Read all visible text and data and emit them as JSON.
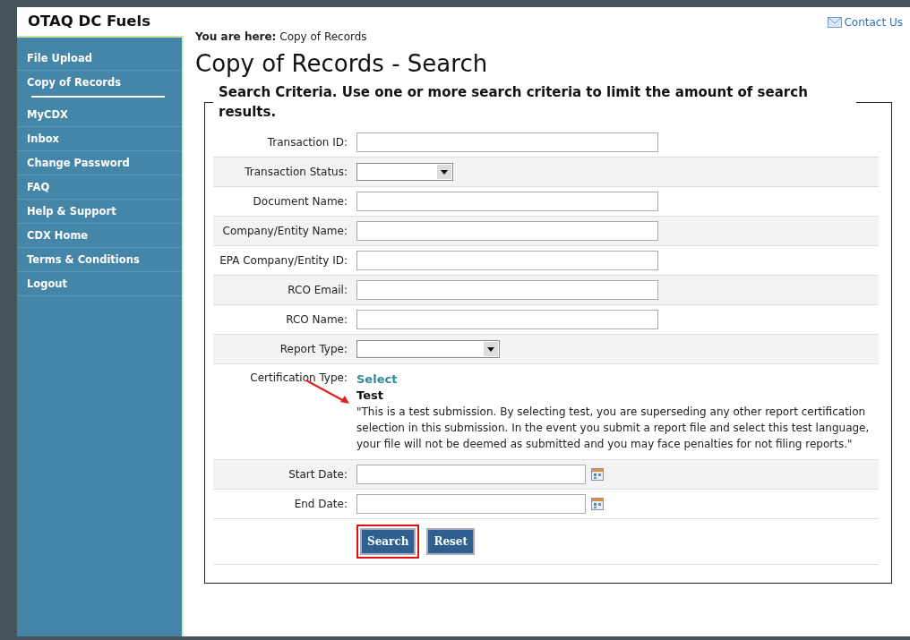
{
  "site_title": "OTAQ DC Fuels",
  "contact_link": "Contact Us",
  "sidebar": {
    "items": [
      {
        "label": "File Upload",
        "selected": false
      },
      {
        "label": "Copy of Records",
        "selected": true
      },
      {
        "label": "MyCDX",
        "selected": false
      },
      {
        "label": "Inbox",
        "selected": false
      },
      {
        "label": "Change Password",
        "selected": false
      },
      {
        "label": "FAQ",
        "selected": false
      },
      {
        "label": "Help & Support",
        "selected": false
      },
      {
        "label": "CDX Home",
        "selected": false
      },
      {
        "label": "Terms & Conditions",
        "selected": false
      },
      {
        "label": "Logout",
        "selected": false
      }
    ]
  },
  "breadcrumb": {
    "prefix": "You are here:",
    "current": "Copy of Records"
  },
  "page_title": "Copy of Records - Search",
  "search_form": {
    "legend": "Search Criteria. Use one or more search criteria to limit the amount of search results.",
    "rows": [
      {
        "kind": "text",
        "label": "Transaction ID:"
      },
      {
        "kind": "select",
        "label": "Transaction Status:"
      },
      {
        "kind": "text",
        "label": "Document Name:"
      },
      {
        "kind": "text",
        "label": "Company/Entity Name:"
      },
      {
        "kind": "text",
        "label": "EPA Company/Entity ID:"
      },
      {
        "kind": "text",
        "label": "RCO Email:"
      },
      {
        "kind": "text",
        "label": "RCO Name:"
      },
      {
        "kind": "wide-select",
        "label": "Report Type:"
      },
      {
        "kind": "certification",
        "label": "Certification Type:",
        "link": "Select",
        "option": "Test",
        "statement": "\"This is a test submission. By selecting test, you are superseding any other report certification selection in this submission. In the event you submit a report file and select this test language, your file will not be deemed as submitted and you may face penalties for not filing reports.\"",
        "arrow": true
      },
      {
        "kind": "date",
        "label": "Start Date:"
      },
      {
        "kind": "date",
        "label": "End Date:"
      }
    ],
    "buttons": [
      {
        "label": "Search",
        "highlighted": true
      },
      {
        "label": "Reset",
        "highlighted": false
      }
    ]
  }
}
